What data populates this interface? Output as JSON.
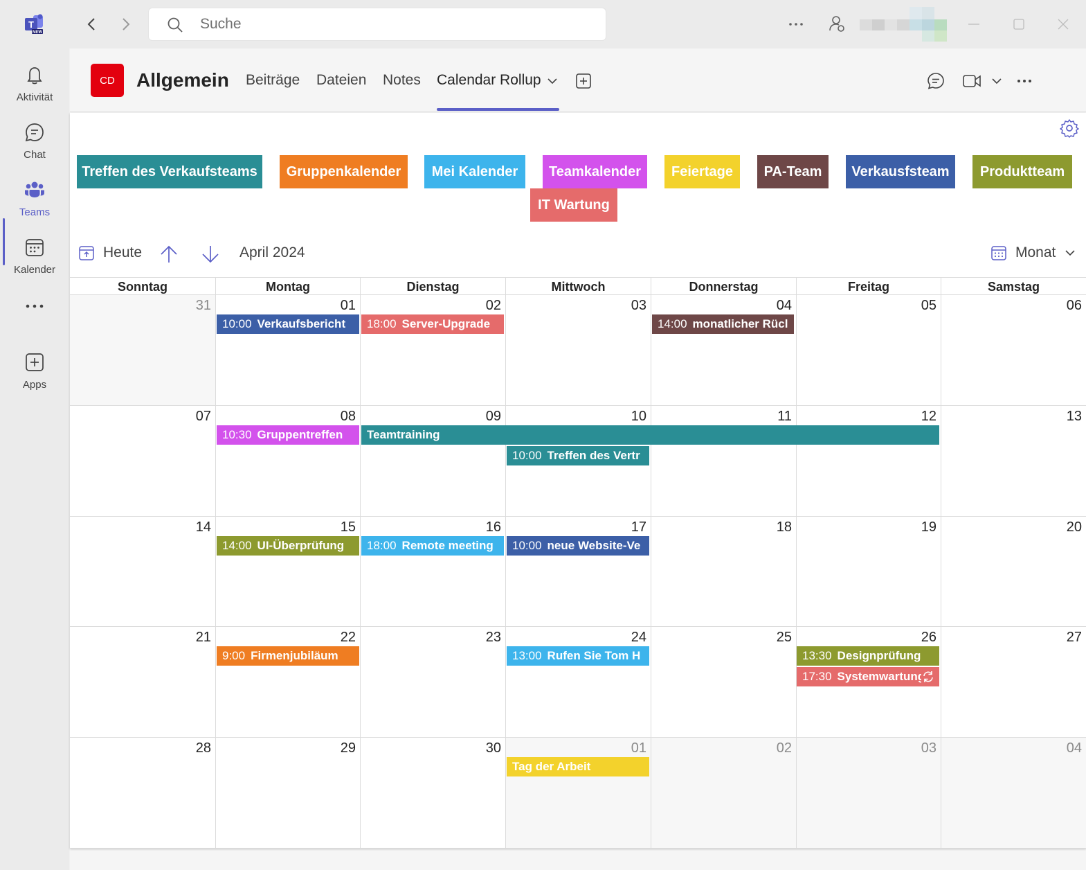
{
  "search": {
    "placeholder": "Suche"
  },
  "rail": {
    "items": [
      {
        "label": "Aktivität",
        "icon": "bell-icon"
      },
      {
        "label": "Chat",
        "icon": "chat-icon"
      },
      {
        "label": "Teams",
        "icon": "teams-icon",
        "active": true
      },
      {
        "label": "Kalender",
        "icon": "calendar-icon"
      },
      {
        "label": "Apps",
        "icon": "add-app-icon"
      }
    ]
  },
  "channel": {
    "avatar": "CD",
    "name": "Allgemein",
    "tabs": [
      "Beiträge",
      "Dateien",
      "Notes",
      "Calendar Rollup"
    ],
    "active_tab": "Calendar Rollup"
  },
  "calendars": [
    {
      "name": "Treffen des Verkaufsteams",
      "color": "#2a8e95"
    },
    {
      "name": "Gruppenkalender",
      "color": "#ef7d22"
    },
    {
      "name": "Mei Kalender",
      "color": "#3db4ec"
    },
    {
      "name": "Teamkalender",
      "color": "#d352ec"
    },
    {
      "name": "Feiertage",
      "color": "#f3d22c"
    },
    {
      "name": "PA-Team",
      "color": "#6e4747"
    },
    {
      "name": "Verkausfsteam",
      "color": "#3c5fa7"
    },
    {
      "name": "Produktteam",
      "color": "#8d9a2f"
    },
    {
      "name": "IT Wartung",
      "color": "#e56b6b"
    }
  ],
  "toolbar": {
    "today": "Heute",
    "month_label": "April 2024",
    "view": "Monat"
  },
  "weekdays": [
    "Sonntag",
    "Montag",
    "Dienstag",
    "Mittwoch",
    "Donnerstag",
    "Freitag",
    "Samstag"
  ],
  "weeks": [
    [
      "31",
      "01",
      "02",
      "03",
      "04",
      "05",
      "06"
    ],
    [
      "07",
      "08",
      "09",
      "10",
      "11",
      "12",
      "13"
    ],
    [
      "14",
      "15",
      "16",
      "17",
      "18",
      "19",
      "20"
    ],
    [
      "21",
      "22",
      "23",
      "24",
      "25",
      "26",
      "27"
    ],
    [
      "28",
      "29",
      "30",
      "01",
      "02",
      "03",
      "04"
    ]
  ],
  "events": [
    {
      "time": "10:00",
      "title": "Verkaufsbericht",
      "color": "#3c5fa7"
    },
    {
      "time": "18:00",
      "title": "Server-Upgrade",
      "color": "#e56b6b"
    },
    {
      "time": "14:00",
      "title": "monatlicher Rücl",
      "color": "#6e4747"
    },
    {
      "time": "10:30",
      "title": "Gruppentreffen",
      "color": "#d352ec"
    },
    {
      "time": "",
      "title": "Teamtraining",
      "color": "#2a8e95"
    },
    {
      "time": "10:00",
      "title": "Treffen des Vertr",
      "color": "#2a8e95"
    },
    {
      "time": "14:00",
      "title": "UI-Überprüfung",
      "color": "#8d9a2f"
    },
    {
      "time": "18:00",
      "title": "Remote meeting",
      "color": "#3db4ec"
    },
    {
      "time": "10:00",
      "title": "neue Website-Ve",
      "color": "#3c5fa7"
    },
    {
      "time": "9:00",
      "title": "Firmenjubiläum",
      "color": "#ef7d22"
    },
    {
      "time": "13:00",
      "title": "Rufen Sie Tom H",
      "color": "#3db4ec"
    },
    {
      "time": "13:30",
      "title": "Designprüfung",
      "color": "#8d9a2f"
    },
    {
      "time": "17:30",
      "title": "Systemwartung",
      "color": "#e56b6b"
    },
    {
      "time": "",
      "title": "Tag der Arbeit",
      "color": "#f3d22c"
    }
  ]
}
